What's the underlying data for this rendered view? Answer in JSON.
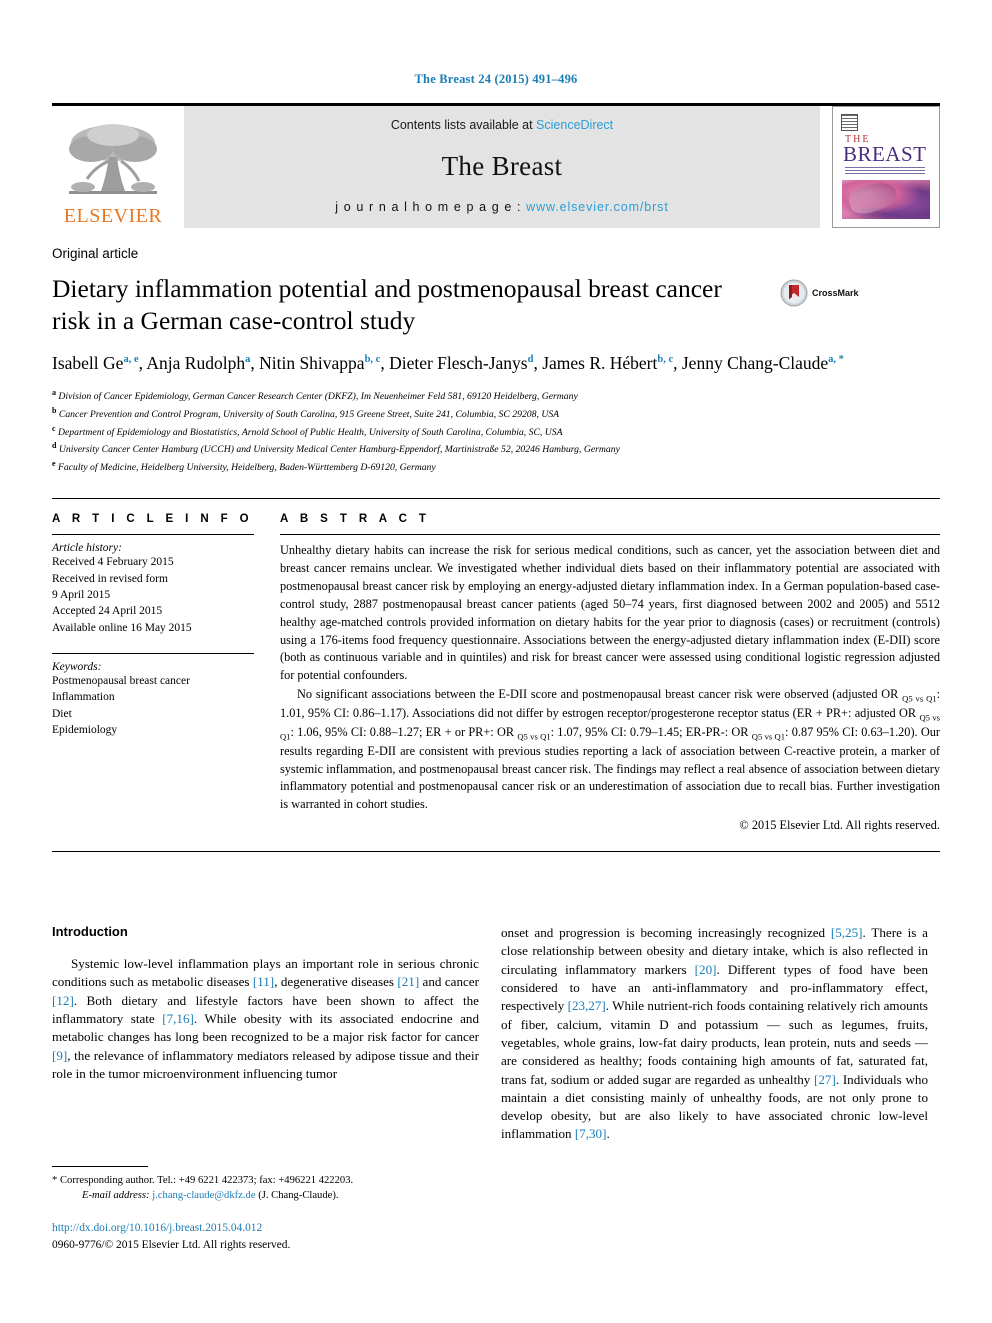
{
  "running_head": "The Breast 24 (2015) 491–496",
  "masthead": {
    "publisher_logo_label": "ELSEVIER",
    "contents_prefix": "Contents lists available at ",
    "contents_source": "ScienceDirect",
    "journal_name": "The Breast",
    "homepage_label": "j o u r n a l   h o m e p a g e :  ",
    "homepage_url": "www.elsevier.com/brst",
    "cover": {
      "the": "THE",
      "title": "BREAST"
    }
  },
  "article": {
    "type": "Original article",
    "title": "Dietary inflammation potential and postmenopausal breast cancer risk in a German case-control study",
    "crossmark_label": "CrossMark",
    "authors": [
      {
        "name": "Isabell Ge",
        "marks": "a, e",
        "sep": ", "
      },
      {
        "name": "Anja Rudolph",
        "marks": "a",
        "sep": ", "
      },
      {
        "name": "Nitin Shivappa",
        "marks": "b, c",
        "sep": ", "
      },
      {
        "name": "Dieter Flesch-Janys",
        "marks": "d",
        "sep": ", "
      },
      {
        "name": "James R. Hébert",
        "marks": "b, c",
        "sep": ", "
      },
      {
        "name": "Jenny Chang-Claude",
        "marks": "a, *",
        "sep": ""
      }
    ],
    "affiliations": [
      {
        "mark": "a",
        "text": "Division of Cancer Epidemiology, German Cancer Research Center (DKFZ), Im Neuenheimer Feld 581, 69120 Heidelberg, Germany"
      },
      {
        "mark": "b",
        "text": "Cancer Prevention and Control Program, University of South Carolina, 915 Greene Street, Suite 241, Columbia, SC 29208, USA"
      },
      {
        "mark": "c",
        "text": "Department of Epidemiology and Biostatistics, Arnold School of Public Health, University of South Carolina, Columbia, SC, USA"
      },
      {
        "mark": "d",
        "text": "University Cancer Center Hamburg (UCCH) and University Medical Center Hamburg-Eppendorf, Martinistraße 52, 20246 Hamburg, Germany"
      },
      {
        "mark": "e",
        "text": "Faculty of Medicine, Heidelberg University, Heidelberg, Baden-Württemberg D-69120, Germany"
      }
    ]
  },
  "article_info": {
    "heading": "A R T I C L E   I N F O",
    "history_label": "Article history:",
    "history": [
      "Received 4 February 2015",
      "Received in revised form",
      "9 April 2015",
      "Accepted 24 April 2015",
      "Available online 16 May 2015"
    ],
    "keywords_label": "Keywords:",
    "keywords": [
      "Postmenopausal breast cancer",
      "Inflammation",
      "Diet",
      "Epidemiology"
    ]
  },
  "abstract": {
    "heading": "A B S T R A C T",
    "paragraph1": "Unhealthy dietary habits can increase the risk for serious medical conditions, such as cancer, yet the association between diet and breast cancer remains unclear. We investigated whether individual diets based on their inflammatory potential are associated with postmenopausal breast cancer risk by employing an energy-adjusted dietary inflammation index. In a German population-based case-control study, 2887 postmenopausal breast cancer patients (aged 50–74 years, first diagnosed between 2002 and 2005) and 5512 healthy age-matched controls provided information on dietary habits for the year prior to diagnosis (cases) or recruitment (controls) using a 176-items food frequency questionnaire. Associations between the energy-adjusted dietary inflammation index (E-DII) score (both as continuous variable and in quintiles) and risk for breast cancer were assessed using conditional logistic regression adjusted for potential confounders.",
    "paragraph2_parts": [
      "No significant associations between the E-DII score and postmenopausal breast cancer risk were observed (adjusted OR ",
      "Q5 vs Q1",
      ": 1.01, 95% CI: 0.86–1.17). Associations did not differ by estrogen receptor/progesterone receptor status (ER + PR+: adjusted OR ",
      "Q5 vs Q1",
      ": 1.06, 95% CI: 0.88–1.27; ER + or PR+: OR ",
      "Q5 vs Q1",
      ": 1.07, 95% CI: 0.79–1.45; ER-PR-: OR ",
      "Q5 vs Q1",
      ": 0.87 95% CI: 0.63–1.20). Our results regarding E-DII are consistent with previous studies reporting a lack of association between C-reactive protein, a marker of systemic inflammation, and postmenopausal breast cancer risk. The findings may reflect a real absence of association between dietary inflammatory potential and postmenopausal cancer risk or an underestimation of association due to recall bias. Further investigation is warranted in cohort studies."
    ],
    "copyright": "© 2015 Elsevier Ltd. All rights reserved."
  },
  "introduction": {
    "heading": "Introduction",
    "left_parts": [
      "Systemic low-level inflammation plays an important role in serious chronic conditions such as metabolic diseases ",
      "[11]",
      ", degenerative diseases ",
      "[21]",
      " and cancer ",
      "[12]",
      ". Both dietary and lifestyle factors have been shown to affect the inflammatory state ",
      "[7,16]",
      ". While obesity with its associated endocrine and metabolic changes has long been recognized to be a major risk factor for cancer ",
      "[9]",
      ", the relevance of inflammatory mediators released by adipose tissue and their role in the tumor microenvironment influencing tumor"
    ],
    "right_parts": [
      "onset and progression is becoming increasingly recognized ",
      "[5,25]",
      ". There is a close relationship between obesity and dietary intake, which is also reflected in circulating inflammatory markers ",
      "[20]",
      ". Different types of food have been considered to have an anti-inflammatory and pro-inflammatory effect, respectively ",
      "[23,27]",
      ". While nutrient-rich foods containing relatively rich amounts of fiber, calcium, vitamin D and potassium — such as legumes, fruits, vegetables, whole grains, low-fat dairy products, lean protein, nuts and seeds — are considered as healthy; foods containing high amounts of fat, saturated fat, trans fat, sodium or added sugar are regarded as unhealthy ",
      "[27]",
      ". Individuals who maintain a diet consisting mainly of unhealthy foods, are not only prone to develop obesity, but are also likely to have associated chronic low-level inflammation ",
      "[7,30]",
      "."
    ]
  },
  "footer": {
    "corresponding_marker": "*",
    "corresponding": "Corresponding author. Tel.: +49 6221 422373; fax: +496221 422203.",
    "email_label": "E-mail address:",
    "email": "j.chang-claude@dkfz.de",
    "email_suffix": "(J. Chang-Claude).",
    "doi": "http://dx.doi.org/10.1016/j.breast.2015.04.012",
    "issn_line": "0960-9776/© 2015 Elsevier Ltd. All rights reserved."
  },
  "colors": {
    "link": "#1a7db6",
    "sciencedirect": "#2a9fd6",
    "elsevier_orange": "#E87722",
    "band_gray": "#e3e3e3"
  }
}
